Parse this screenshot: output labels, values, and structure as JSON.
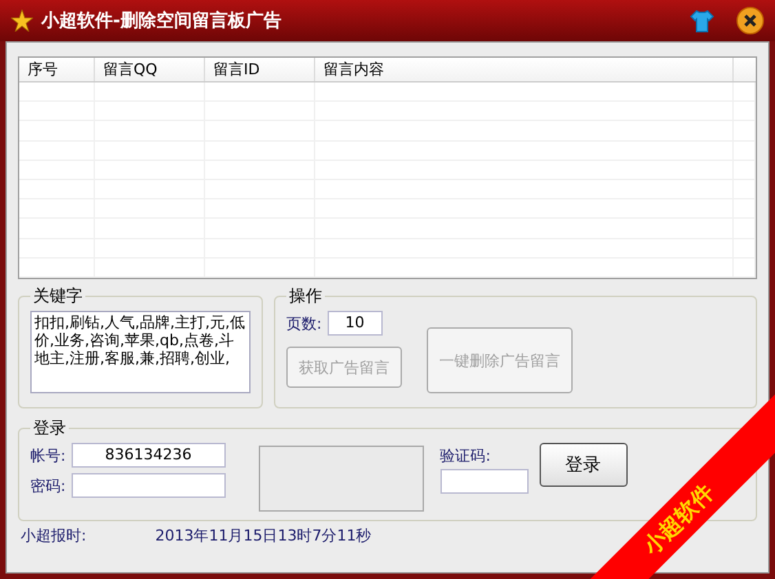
{
  "window": {
    "title": "小超软件-删除空间留言板广告"
  },
  "table": {
    "columns": [
      "序号",
      "留言QQ",
      "留言ID",
      "留言内容"
    ]
  },
  "keywords": {
    "title": "关键字",
    "value": "扣扣,刷钻,人气,品牌,主打,元,低价,业务,咨询,苹果,qb,点卷,斗地主,注册,客服,兼,招聘,创业,"
  },
  "operation": {
    "title": "操作",
    "pages_label": "页数:",
    "pages_value": "10",
    "buttons": [
      {
        "label": "获取广告留言",
        "disabled": true
      },
      {
        "label": "一键删除广告留言",
        "disabled": true
      }
    ]
  },
  "login": {
    "title": "登录",
    "account_label": "帐号:",
    "account_value": "836134236",
    "password_label": "密码:",
    "captcha_label": "验证码:",
    "login_button": "登录"
  },
  "status_bar": {
    "label": "小超报时:",
    "time": "2013年11月15日13时7分11秒"
  },
  "ribbon": {
    "text": "小超软件"
  }
}
